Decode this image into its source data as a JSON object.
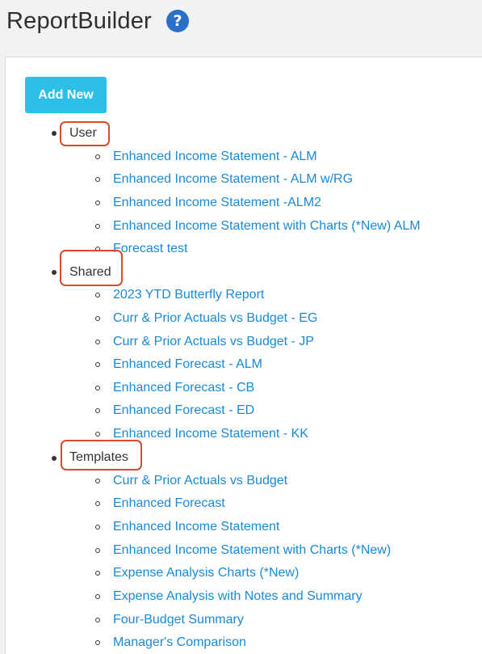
{
  "header": {
    "title": "ReportBuilder",
    "help_icon": "?"
  },
  "toolbar": {
    "add_new_label": "Add New"
  },
  "groups": [
    {
      "label": "User",
      "items": [
        "Enhanced Income Statement - ALM",
        "Enhanced Income Statement - ALM w/RG",
        "Enhanced Income Statement -ALM2",
        "Enhanced Income Statement with Charts (*New) ALM",
        "Forecast test"
      ]
    },
    {
      "label": "Shared",
      "items": [
        "2023 YTD Butterfly Report",
        "Curr & Prior Actuals vs Budget - EG",
        "Curr & Prior Actuals vs Budget - JP",
        "Enhanced Forecast - ALM",
        "Enhanced Forecast - CB",
        "Enhanced Forecast - ED",
        "Enhanced Income Statement - KK"
      ]
    },
    {
      "label": "Templates",
      "items": [
        "Curr & Prior Actuals vs Budget",
        "Enhanced Forecast",
        "Enhanced Income Statement",
        "Enhanced Income Statement with Charts (*New)",
        "Expense Analysis Charts (*New)",
        "Expense Analysis with Notes and Summary",
        "Four-Budget Summary",
        "Manager's Comparison"
      ]
    }
  ],
  "colors": {
    "link": "#1a8ad4",
    "add_button": "#2cc0e8",
    "help_icon": "#2a6fc9",
    "callout": "#d84a2b"
  }
}
